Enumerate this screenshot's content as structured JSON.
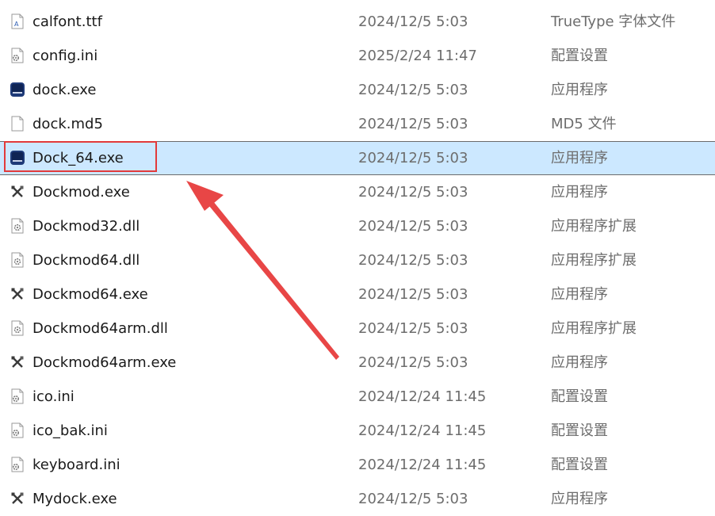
{
  "files": [
    {
      "name": "calfont.ttf",
      "date": "2024/12/5 5:03",
      "type": "TrueType 字体文件",
      "icon": "font-file-icon"
    },
    {
      "name": "config.ini",
      "date": "2025/2/24 11:47",
      "type": "配置设置",
      "icon": "settings-file-icon"
    },
    {
      "name": "dock.exe",
      "date": "2024/12/5 5:03",
      "type": "应用程序",
      "icon": "app-window-icon"
    },
    {
      "name": "dock.md5",
      "date": "2024/12/5 5:03",
      "type": "MD5 文件",
      "icon": "blank-file-icon"
    },
    {
      "name": "Dock_64.exe",
      "date": "2024/12/5 5:03",
      "type": "应用程序",
      "icon": "app-window-icon"
    },
    {
      "name": "Dockmod.exe",
      "date": "2024/12/5 5:03",
      "type": "应用程序",
      "icon": "tools-icon"
    },
    {
      "name": "Dockmod32.dll",
      "date": "2024/12/5 5:03",
      "type": "应用程序扩展",
      "icon": "dll-file-icon"
    },
    {
      "name": "Dockmod64.dll",
      "date": "2024/12/5 5:03",
      "type": "应用程序扩展",
      "icon": "dll-file-icon"
    },
    {
      "name": "Dockmod64.exe",
      "date": "2024/12/5 5:03",
      "type": "应用程序",
      "icon": "tools-icon"
    },
    {
      "name": "Dockmod64arm.dll",
      "date": "2024/12/5 5:03",
      "type": "应用程序扩展",
      "icon": "dll-file-icon"
    },
    {
      "name": "Dockmod64arm.exe",
      "date": "2024/12/5 5:03",
      "type": "应用程序",
      "icon": "tools-icon"
    },
    {
      "name": "ico.ini",
      "date": "2024/12/24 11:45",
      "type": "配置设置",
      "icon": "settings-file-icon"
    },
    {
      "name": "ico_bak.ini",
      "date": "2024/12/24 11:45",
      "type": "配置设置",
      "icon": "settings-file-icon"
    },
    {
      "name": "keyboard.ini",
      "date": "2024/12/24 11:45",
      "type": "配置设置",
      "icon": "settings-file-icon"
    },
    {
      "name": "Mydock.exe",
      "date": "2024/12/5 5:03",
      "type": "应用程序",
      "icon": "tools-icon"
    }
  ],
  "selected_index": 4,
  "colors": {
    "selection": "#cce8ff",
    "annotation": "#e23a3a",
    "secondary_text": "#6d6d6d"
  }
}
